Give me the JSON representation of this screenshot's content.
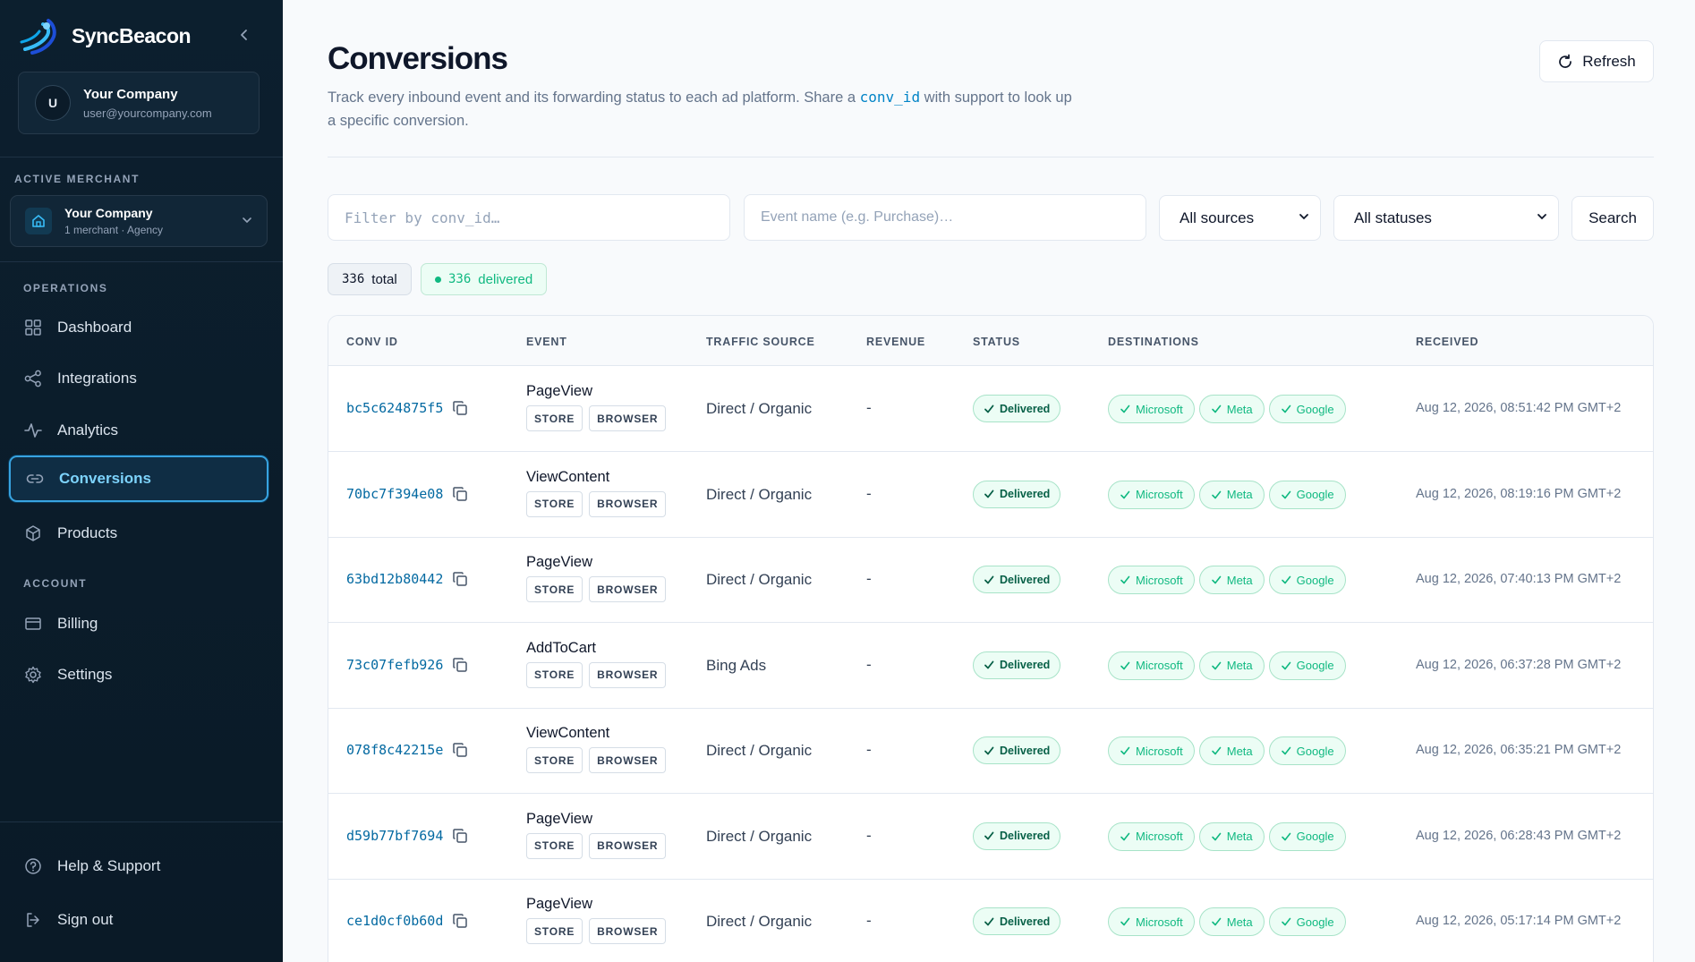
{
  "sidebar": {
    "brand": "SyncBeacon",
    "user": {
      "initial": "U",
      "company": "Your Company",
      "email": "user@yourcompany.com"
    },
    "active_merchant_label": "ACTIVE MERCHANT",
    "merchant": {
      "name": "Your Company",
      "sub": "1 merchant · Agency"
    },
    "operations_label": "OPERATIONS",
    "account_label": "ACCOUNT",
    "nav": {
      "dashboard": "Dashboard",
      "integrations": "Integrations",
      "analytics": "Analytics",
      "conversions": "Conversions",
      "products": "Products",
      "billing": "Billing",
      "settings": "Settings"
    },
    "help": "Help & Support",
    "signout": "Sign out",
    "colors": {
      "bg": "#0c1f2e",
      "active_border": "#38a3e0",
      "active_text": "#7dd3fc"
    }
  },
  "header": {
    "title": "Conversions",
    "desc_before": "Track every inbound event and its forwarding status to each ad platform. Share a ",
    "desc_code": "conv_id",
    "desc_after": " with support to look up a specific conversion.",
    "refresh": "Refresh"
  },
  "filters": {
    "conv_placeholder": "Filter by conv_id…",
    "event_placeholder": "Event name (e.g. Purchase)…",
    "source_value": "All sources",
    "status_value": "All statuses",
    "search": "Search"
  },
  "summary": {
    "total_count": "336",
    "total_label": "total",
    "delivered_count": "336",
    "delivered_label": "delivered"
  },
  "table": {
    "headers": {
      "conv_id": "CONV ID",
      "event": "EVENT",
      "source": "TRAFFIC SOURCE",
      "revenue": "REVENUE",
      "status": "STATUS",
      "destinations": "DESTINATIONS",
      "received": "RECEIVED"
    },
    "rows": [
      {
        "id": "bc5c624875f5",
        "event": "PageView",
        "tag1": "STORE",
        "tag2": "BROWSER",
        "source": "Direct / Organic",
        "revenue": "-",
        "status": "Delivered",
        "d1": "Microsoft",
        "d2": "Meta",
        "d3": "Google",
        "received": "Aug 12, 2026, 08:51:42 PM GMT+2"
      },
      {
        "id": "70bc7f394e08",
        "event": "ViewContent",
        "tag1": "STORE",
        "tag2": "BROWSER",
        "source": "Direct / Organic",
        "revenue": "-",
        "status": "Delivered",
        "d1": "Microsoft",
        "d2": "Meta",
        "d3": "Google",
        "received": "Aug 12, 2026, 08:19:16 PM GMT+2"
      },
      {
        "id": "63bd12b80442",
        "event": "PageView",
        "tag1": "STORE",
        "tag2": "BROWSER",
        "source": "Direct / Organic",
        "revenue": "-",
        "status": "Delivered",
        "d1": "Microsoft",
        "d2": "Meta",
        "d3": "Google",
        "received": "Aug 12, 2026, 07:40:13 PM GMT+2"
      },
      {
        "id": "73c07fefb926",
        "event": "AddToCart",
        "tag1": "STORE",
        "tag2": "BROWSER",
        "source": "Bing Ads",
        "revenue": "-",
        "status": "Delivered",
        "d1": "Microsoft",
        "d2": "Meta",
        "d3": "Google",
        "received": "Aug 12, 2026, 06:37:28 PM GMT+2"
      },
      {
        "id": "078f8c42215e",
        "event": "ViewContent",
        "tag1": "STORE",
        "tag2": "BROWSER",
        "source": "Direct / Organic",
        "revenue": "-",
        "status": "Delivered",
        "d1": "Microsoft",
        "d2": "Meta",
        "d3": "Google",
        "received": "Aug 12, 2026, 06:35:21 PM GMT+2"
      },
      {
        "id": "d59b77bf7694",
        "event": "PageView",
        "tag1": "STORE",
        "tag2": "BROWSER",
        "source": "Direct / Organic",
        "revenue": "-",
        "status": "Delivered",
        "d1": "Microsoft",
        "d2": "Meta",
        "d3": "Google",
        "received": "Aug 12, 2026, 06:28:43 PM GMT+2"
      },
      {
        "id": "ce1d0cf0b60d",
        "event": "PageView",
        "tag1": "STORE",
        "tag2": "BROWSER",
        "source": "Direct / Organic",
        "revenue": "-",
        "status": "Delivered",
        "d1": "Microsoft",
        "d2": "Meta",
        "d3": "Google",
        "received": "Aug 12, 2026, 05:17:14 PM GMT+2"
      }
    ]
  },
  "colors": {
    "accent": "#0284c7",
    "success": "#10b981",
    "success_bg": "#ecfdf5"
  }
}
